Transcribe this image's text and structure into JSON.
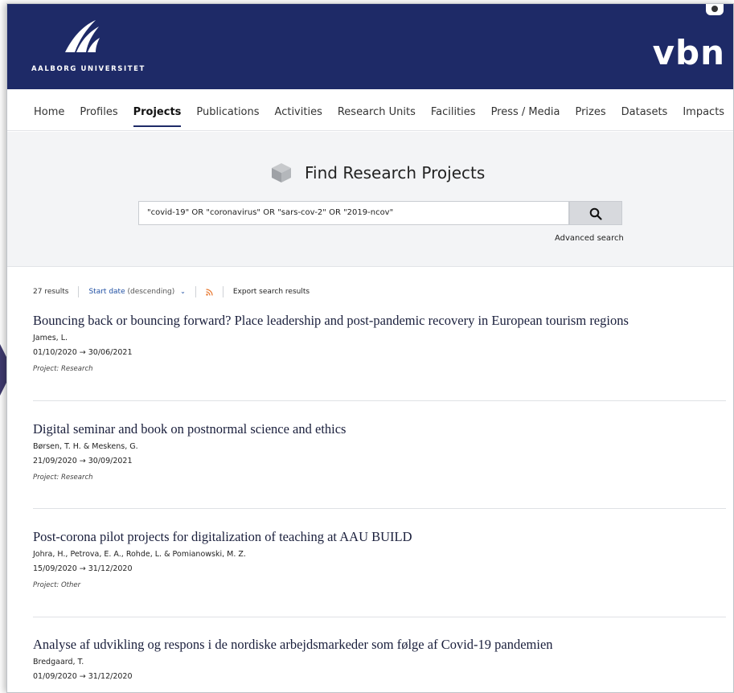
{
  "header": {
    "university": "AALBORG UNIVERSITET",
    "brand": "vbn",
    "bg_color": "#1e2a67"
  },
  "nav": {
    "items": [
      {
        "label": "Home"
      },
      {
        "label": "Profiles"
      },
      {
        "label": "Projects",
        "active": true
      },
      {
        "label": "Publications"
      },
      {
        "label": "Activities"
      },
      {
        "label": "Research Units"
      },
      {
        "label": "Facilities"
      },
      {
        "label": "Press / Media"
      },
      {
        "label": "Prizes"
      },
      {
        "label": "Datasets"
      },
      {
        "label": "Impacts"
      }
    ]
  },
  "search": {
    "title": "Find Research Projects",
    "query": "\"covid-19\" OR \"coronavirus\" OR \"sars-cov-2\" OR \"2019-ncov\"",
    "advanced_label": "Advanced search",
    "button_icon": "search-icon"
  },
  "toolbar": {
    "results_count": "27 results",
    "sort_label": "Start date",
    "sort_order": "(descending)",
    "export_label": "Export search results",
    "rss_color": "#e8772e"
  },
  "results": [
    {
      "title": "Bouncing back or bouncing forward? Place leadership and post-pandemic recovery in European tourism regions",
      "authors": "James, L.",
      "dates": "01/10/2020 → 30/06/2021",
      "type": "Project: Research"
    },
    {
      "title": "Digital seminar and book on postnormal science and ethics",
      "authors": "Børsen, T. H. & Meskens, G.",
      "dates": "21/09/2020 → 30/09/2021",
      "type": "Project: Research"
    },
    {
      "title": "Post-corona pilot projects for digitalization of teaching at AAU BUILD",
      "authors": "Johra, H., Petrova, E. A., Rohde, L. & Pomianowski, M. Z.",
      "dates": "15/09/2020 → 31/12/2020",
      "type": "Project: Other"
    },
    {
      "title": "Analyse af udvikling og respons i de nordiske arbejdsmarkeder som følge af Covid-19 pandemien",
      "authors": "Bredgaard, T.",
      "dates": "01/09/2020 → 31/12/2020",
      "type": ""
    }
  ]
}
